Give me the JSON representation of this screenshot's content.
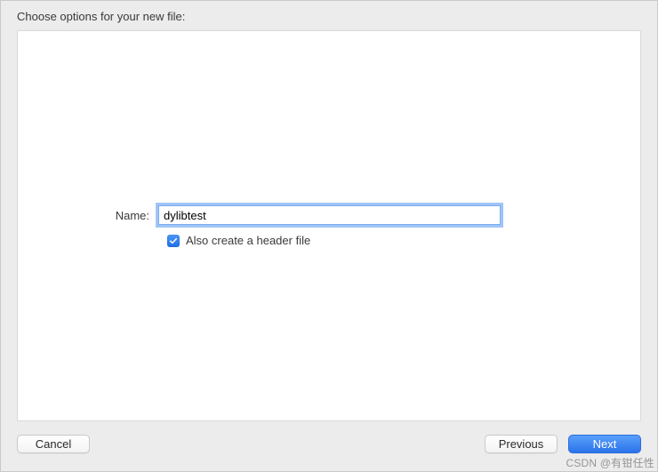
{
  "prompt": "Choose options for your new file:",
  "form": {
    "name_label": "Name:",
    "name_value": "dylibtest",
    "header_checkbox_label": "Also create a header file",
    "header_checkbox_checked": true
  },
  "buttons": {
    "cancel": "Cancel",
    "previous": "Previous",
    "next": "Next"
  },
  "watermark": "CSDN @有钳任性"
}
